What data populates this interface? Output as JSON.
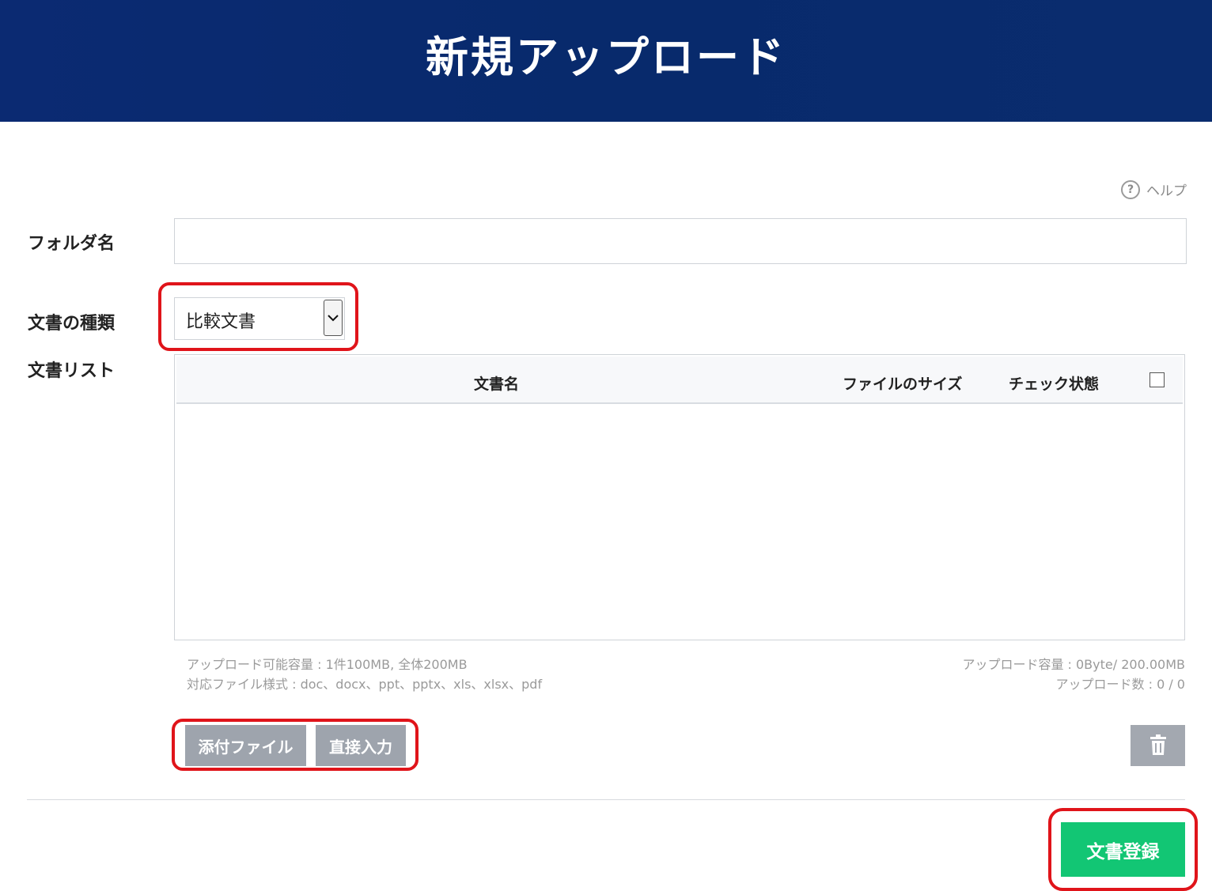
{
  "header": {
    "title": "新規アップロード"
  },
  "help": {
    "label": "ヘルプ",
    "icon": "question-circle-icon"
  },
  "form": {
    "folder_label": "フォルダ名",
    "folder_value": "",
    "doc_type_label": "文書の種類",
    "doc_type_value": "比較文書",
    "doc_list_label": "文書リスト"
  },
  "table": {
    "columns": [
      "文書名",
      "ファイルのサイズ",
      "チェック状態"
    ],
    "rows": []
  },
  "upload_info": {
    "limit": "アップロード可能容量 : 1件100MB, 全体200MB",
    "formats": "対応ファイル様式 : doc、docx、ppt、pptx、xls、xlsx、pdf",
    "capacity": "アップロード容量 : 0Byte/ 200.00MB",
    "count": "アップロード数 : 0 / 0"
  },
  "buttons": {
    "attach": "添付ファイル",
    "direct_input": "直接入力",
    "register": "文書登録",
    "delete_icon": "trash-icon"
  },
  "colors": {
    "header_bg": "#082a6c",
    "register_green": "#12c674",
    "highlight_red": "#e0141a"
  }
}
